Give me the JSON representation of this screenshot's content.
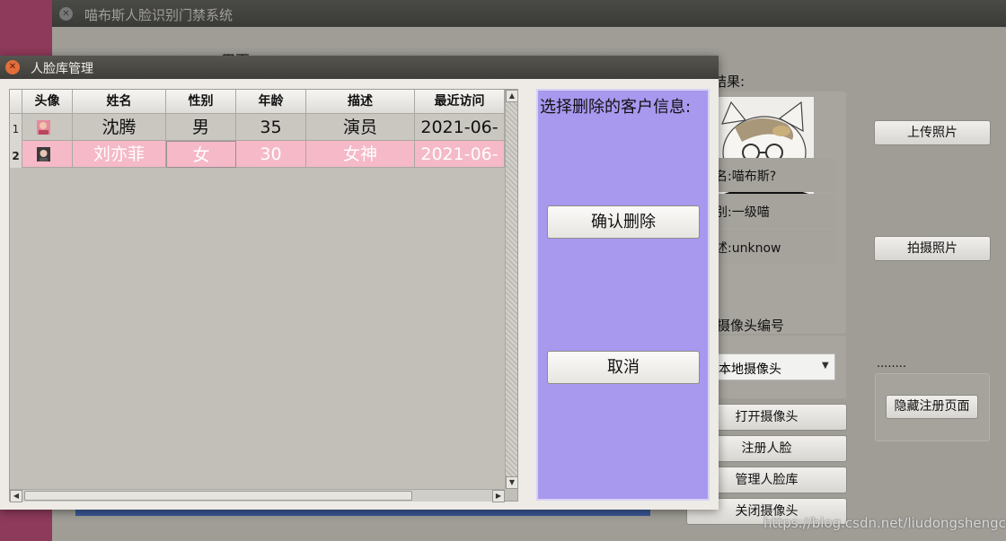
{
  "main_window": {
    "title": "喵布斯人脸识别门禁系统",
    "partial_hidden_text": "用页",
    "recognition_label": "识别结果:",
    "info": [
      "名:喵布斯?",
      "别:一级喵",
      "述:unknow"
    ],
    "buttons": {
      "upload_photo": "上传照片",
      "take_photo": "拍摄照片",
      "open_camera": "打开摄像头",
      "register_face": "注册人脸",
      "manage_library": "管理人脸库",
      "close_camera": "关闭摄像头",
      "hide_register": "隐藏注册页面"
    },
    "camera_label": "摄像头编号",
    "camera_select_value": "本地摄像头",
    "dots": "........"
  },
  "dialog": {
    "title": "人脸库管理",
    "table": {
      "headers": [
        "头像",
        "姓名",
        "性别",
        "年龄",
        "描述",
        "最近访问"
      ],
      "rows": [
        {
          "num": "1",
          "name": "沈腾",
          "gender": "男",
          "age": "35",
          "desc": "演员",
          "last_visit": "2021-06-"
        },
        {
          "num": "2",
          "name": "刘亦菲",
          "gender": "女",
          "age": "30",
          "desc": "女神",
          "last_visit": "2021-06-"
        }
      ],
      "selected_row": 2
    },
    "right_panel": {
      "title": "选择删除的客户信息:",
      "confirm_button": "确认删除",
      "cancel_button": "取消"
    }
  },
  "watermark": "https://blog.csdn.net/liudongshengcn",
  "icons": {
    "close": "close-icon",
    "avatar": "avatar-thumbnail",
    "dropdown": "chevron-down-icon"
  },
  "colors": {
    "desktop": "#8e3a5a",
    "dialog_right_panel": "#a898ee",
    "selected_row": "#f5b9c8",
    "close_button": "#e46e3a"
  }
}
